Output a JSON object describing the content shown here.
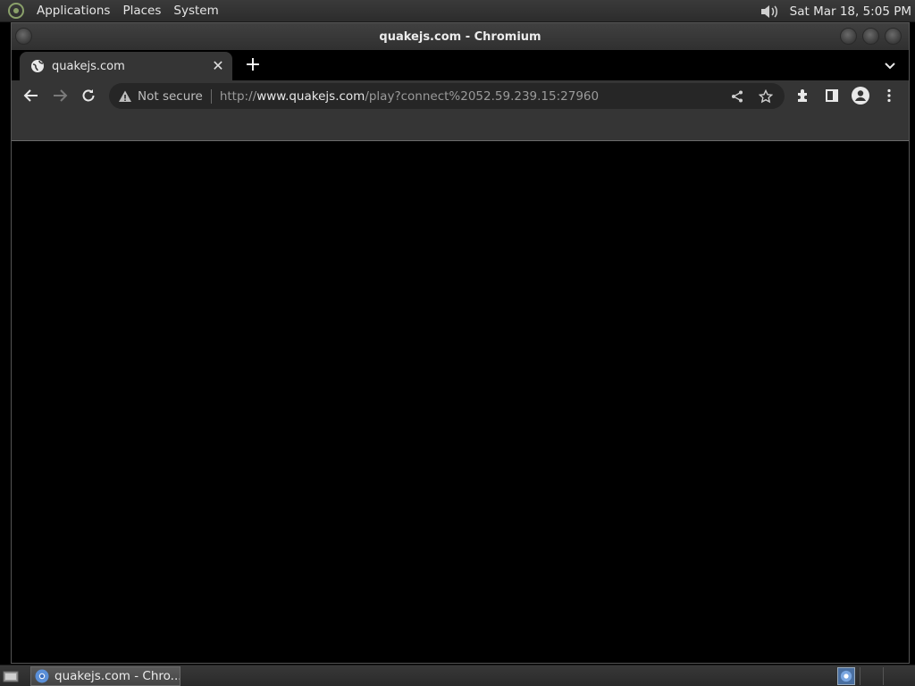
{
  "top_panel": {
    "menus": [
      "Applications",
      "Places",
      "System"
    ],
    "clock": "Sat Mar 18,  5:05 PM"
  },
  "window": {
    "title": "quakejs.com - Chromium"
  },
  "tab": {
    "title": "quakejs.com",
    "close_glyph": "✕",
    "new_tab_glyph": "+"
  },
  "omnibox": {
    "security_label": "Not secure",
    "url_scheme": "http://",
    "url_host": "www.quakejs.com",
    "url_rest": "/play?connect%2052.59.239.15:27960"
  },
  "taskbar": {
    "task_label": "quakejs.com - Chro..."
  },
  "icons": {
    "menu_logo": "gnome-foot-icon",
    "volume": "volume-icon",
    "favicon": "globe-icon",
    "back": "back-arrow-icon",
    "forward": "forward-arrow-icon",
    "reload": "reload-icon",
    "warning": "warning-icon",
    "share": "share-icon",
    "bookmark": "star-icon",
    "extensions": "puzzle-icon",
    "side_panel": "side-panel-icon",
    "profile": "profile-icon",
    "menu": "kebab-menu-icon",
    "tab_search": "chevron-down-icon"
  }
}
